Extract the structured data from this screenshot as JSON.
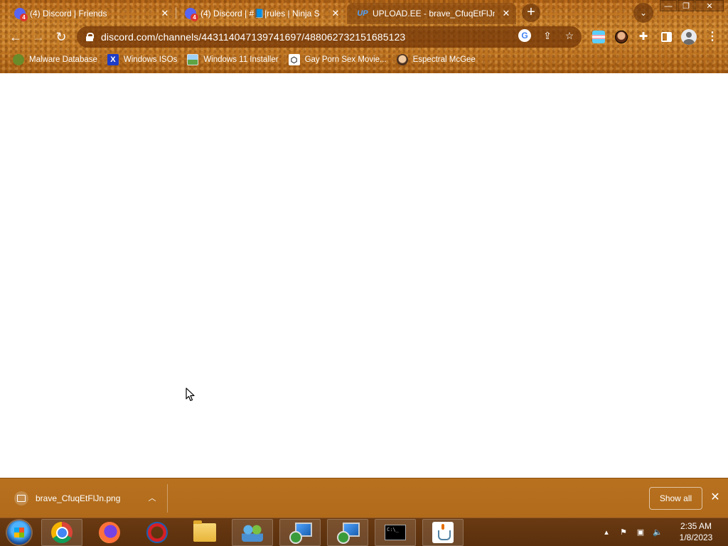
{
  "browser": {
    "tabs": [
      {
        "title": "(4) Discord | Friends",
        "badge": "4",
        "active": false
      },
      {
        "title": "(4) Discord | #📘|rules | Ninja S",
        "badge": "4",
        "active": false
      },
      {
        "title": "UPLOAD.EE - brave_CfuqEtFlJn.p",
        "favicon_text": "UP",
        "active": true
      }
    ],
    "new_tab_symbol": "+",
    "tab_close_symbol": "✕",
    "url": "discord.com/channels/443114047139741697/488062732151685123",
    "bookmarks": [
      {
        "label": "Malware Database",
        "icon": "malware-database-icon"
      },
      {
        "label": "Windows ISOs",
        "icon": "x-icon",
        "icon_text": "X"
      },
      {
        "label": "Windows 11 Installer",
        "icon": "image-icon"
      },
      {
        "label": "Gay Porn Sex Movie...",
        "icon": "cube-icon"
      },
      {
        "label": "Espectral McGee",
        "icon": "face-icon"
      }
    ]
  },
  "download_shelf": {
    "file_name": "brave_CfuqEtFlJn.png",
    "show_all_label": "Show all"
  },
  "taskbar": {
    "clock_time": "2:35 AM",
    "clock_date": "1/8/2023"
  },
  "colors": {
    "theme_orange": "#c07622",
    "download_shelf": "#b06a1a",
    "taskbar": "#5a300d",
    "discord_blurple": "#5865f2",
    "badge_red": "#e0352b"
  }
}
